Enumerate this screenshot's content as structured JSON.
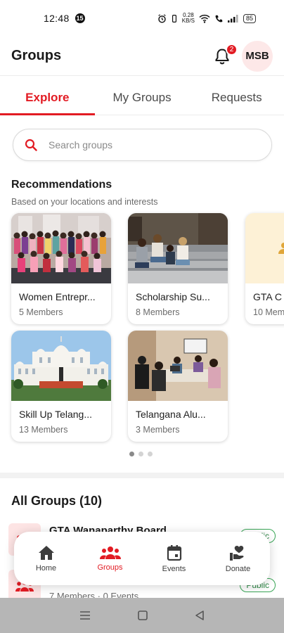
{
  "status_bar": {
    "time": "12:48",
    "notif_count": "15",
    "net_speed_top": "0.28",
    "net_speed_bottom": "KB/S",
    "battery": "85"
  },
  "header": {
    "title": "Groups",
    "notification_count": "2",
    "avatar_initials": "MSB"
  },
  "tabs": [
    {
      "label": "Explore",
      "active": true
    },
    {
      "label": "My Groups",
      "active": false
    },
    {
      "label": "Requests",
      "active": false
    }
  ],
  "search": {
    "placeholder": "Search groups"
  },
  "recommendations": {
    "title": "Recommendations",
    "subtitle": "Based on your locations and interests",
    "cards": [
      {
        "name": "Women Entrepr...",
        "members": "5 Members",
        "image": "group-photo-women"
      },
      {
        "name": "Scholarship Su...",
        "members": "8 Members",
        "image": "students-on-steps"
      },
      {
        "name": "GTA C",
        "members": "10 Mem",
        "image": "group-placeholder-icon"
      },
      {
        "name": "Skill Up Telang...",
        "members": "13 Members",
        "image": "government-building"
      },
      {
        "name": "Telangana Alu...",
        "members": "3 Members",
        "image": "meeting-room"
      }
    ],
    "carousel_pages": 3,
    "carousel_active": 0
  },
  "all_groups": {
    "title": "All Groups (10)",
    "items": [
      {
        "name": "GTA Wanaparthy Board",
        "meta": "",
        "visibility": "Public"
      },
      {
        "name": "",
        "meta": "7 Members · 0 Events",
        "visibility": "Public"
      }
    ]
  },
  "bottom_nav": {
    "items": [
      {
        "label": "Home",
        "icon": "home-icon",
        "active": false
      },
      {
        "label": "Groups",
        "icon": "groups-icon",
        "active": true
      },
      {
        "label": "Events",
        "icon": "calendar-icon",
        "active": false
      },
      {
        "label": "Donate",
        "icon": "donate-icon",
        "active": false
      }
    ]
  },
  "colors": {
    "accent": "#e21b23",
    "public_badge": "#3aa657",
    "avatar_bg": "#fde8e8"
  }
}
